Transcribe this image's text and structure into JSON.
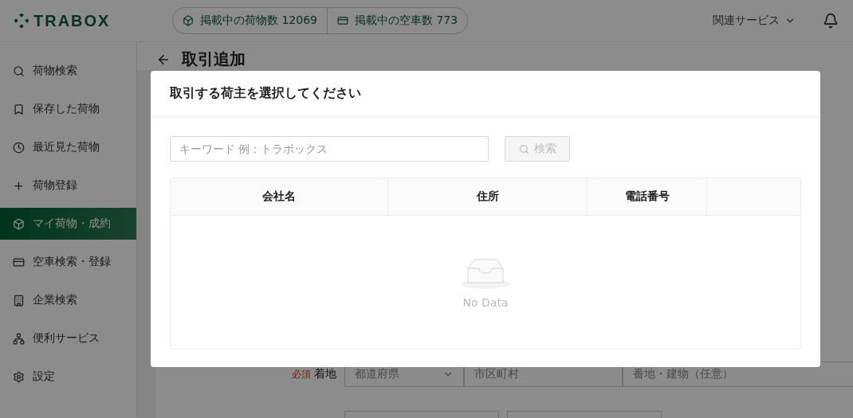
{
  "header": {
    "logo": "TRABOX",
    "stats": [
      {
        "kind": "cargo",
        "label": "掲載中の荷物数 12069"
      },
      {
        "kind": "truck",
        "label": "掲載中の空車数 773"
      }
    ],
    "services_menu": "関連サービス"
  },
  "sidebar": {
    "items": [
      {
        "label": "荷物検索",
        "selected": false
      },
      {
        "label": "保存した荷物",
        "selected": false
      },
      {
        "label": "最近見た荷物",
        "selected": false
      },
      {
        "label": "荷物登録",
        "selected": false
      },
      {
        "label": "マイ荷物・成約",
        "selected": true
      },
      {
        "label": "空車検索・登録",
        "selected": false
      },
      {
        "label": "企業検索",
        "selected": false
      },
      {
        "label": "便利サービス",
        "selected": false
      },
      {
        "label": "設定",
        "selected": false
      }
    ]
  },
  "page": {
    "title": "取引追加",
    "form_row": {
      "required": "必須",
      "label": "着地",
      "prefecture": "都道府県",
      "city": "市区町村",
      "address": "番地・建物（任意）"
    }
  },
  "dialog": {
    "title": "取引する荷主を選択してください",
    "search": {
      "placeholder": "キーワード 例：トラボックス",
      "button": "検索",
      "disabled": true
    },
    "table": {
      "columns": [
        "会社名",
        "住所",
        "電話番号",
        ""
      ],
      "empty_text": "No Data"
    }
  }
}
